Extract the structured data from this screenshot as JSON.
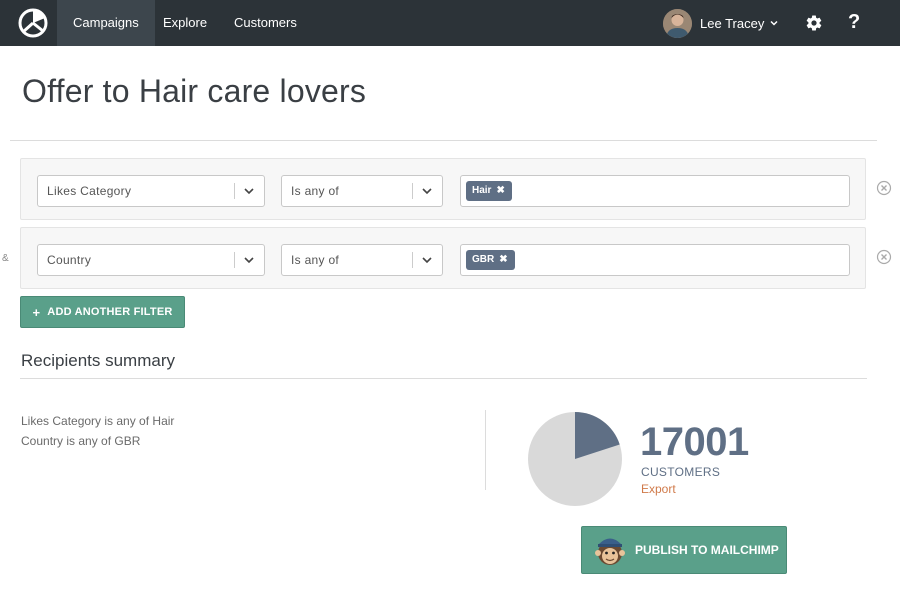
{
  "nav": {
    "tabs": [
      {
        "label": "Campaigns",
        "active": true
      },
      {
        "label": "Explore",
        "active": false
      },
      {
        "label": "Customers",
        "active": false
      }
    ],
    "user_name": "Lee Tracey",
    "help_label": "?"
  },
  "page": {
    "title": "Offer to Hair care lovers"
  },
  "filters": [
    {
      "field": "Likes Category",
      "operator": "Is any of",
      "values": [
        "Hair"
      ]
    },
    {
      "field": "Country",
      "operator": "Is any of",
      "values": [
        "GBR"
      ]
    }
  ],
  "filter_joiner": "&",
  "add_filter_label": "ADD ANOTHER FILTER",
  "summary": {
    "title": "Recipients summary",
    "lines": [
      "Likes Category is any of Hair",
      "Country is any of GBR"
    ],
    "count": "17001",
    "count_label": "CUSTOMERS",
    "export_label": "Export",
    "matched_fraction": 0.2,
    "publish_label": "PUBLISH TO MAILCHIMP"
  },
  "colors": {
    "nav_bg": "#2c3338",
    "accent_green": "#5aa08a",
    "tag_slate": "#5f6f85",
    "export_orange": "#d07a4a",
    "pie_rest": "#d9d9d9"
  },
  "icons": {
    "tag_remove": "✖"
  }
}
